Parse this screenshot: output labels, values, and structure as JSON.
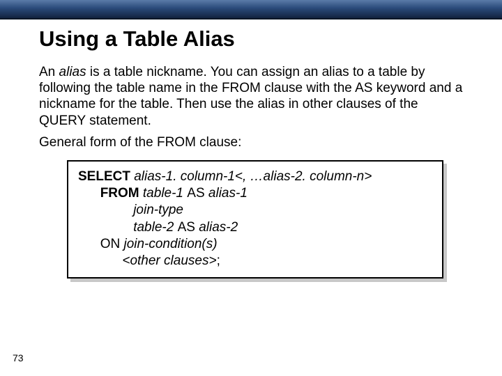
{
  "title": "Using a Table Alias",
  "para1_pre": "An ",
  "para1_em": "alias",
  "para1_post": " is a table nickname. You can assign an alias to a table by following the table name in the FROM clause with the AS keyword and a nickname for the table. Then use the alias in other clauses of the QUERY statement.",
  "para2": "General form of the FROM clause:",
  "code": {
    "l1_kw": "SELECT",
    "l1_it": " alias-1. column-1<, …alias-2. column-n>",
    "l2_kw": "FROM",
    "l2_it1": " table-1 ",
    "l2_as": "AS",
    "l2_it2": " alias-1",
    "l3_it": "join-type",
    "l4_it1": "table-2 ",
    "l4_as": "AS",
    "l4_it2": " alias-2",
    "l5_on": "ON",
    "l5_it": " join-condition(s)",
    "l6_it": "<other clauses>",
    "l6_semi": ";"
  },
  "page": "73"
}
